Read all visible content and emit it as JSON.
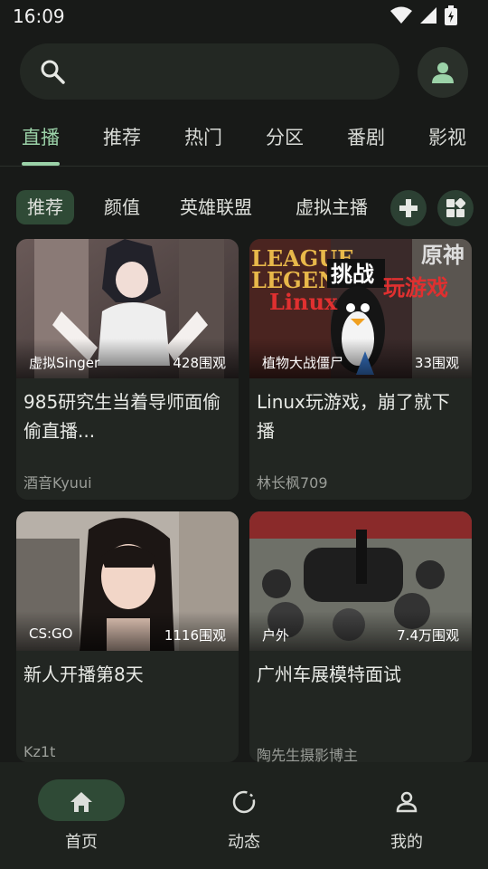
{
  "status": {
    "time": "16:09"
  },
  "search": {
    "placeholder": ""
  },
  "tabs": [
    "直播",
    "推荐",
    "热门",
    "分区",
    "番剧",
    "影视"
  ],
  "chips": [
    "推荐",
    "颜值",
    "英雄联盟",
    "虚拟主播"
  ],
  "chip_buttons": [
    "gamepad-icon",
    "grid-icon"
  ],
  "cards": [
    {
      "category": "虚拟Singer",
      "views": "428围观",
      "title": "985研究生当着导师面偷偷直播...",
      "author": "酒音Kyuui"
    },
    {
      "category": "植物大战僵尸",
      "views": "33围观",
      "title": "Linux玩游戏，崩了就下播",
      "author": "林长枫709"
    },
    {
      "category": "CS:GO",
      "views": "1116围观",
      "title": "新人开播第8天",
      "author": "Kz1t"
    },
    {
      "category": "户外",
      "views": "7.4万围观",
      "title": "广州车展模特面试",
      "author": "陶先生摄影博主"
    }
  ],
  "thumb_art": {
    "card2_badge": "挑战",
    "card2_text": "Linux",
    "card2_text2": "玩游戏",
    "card2_bg_left": "LEAGUE",
    "card2_bg_left2": "LEGEND",
    "card2_bg_right": "原神"
  },
  "nav": [
    {
      "label": "首页",
      "icon": "home-icon"
    },
    {
      "label": "动态",
      "icon": "dynamic-icon"
    },
    {
      "label": "我的",
      "icon": "profile-icon"
    }
  ],
  "colors": {
    "accent": "#9bd2a8",
    "active_bg": "#2f4a36",
    "background": "#181a18",
    "card": "#222622"
  }
}
